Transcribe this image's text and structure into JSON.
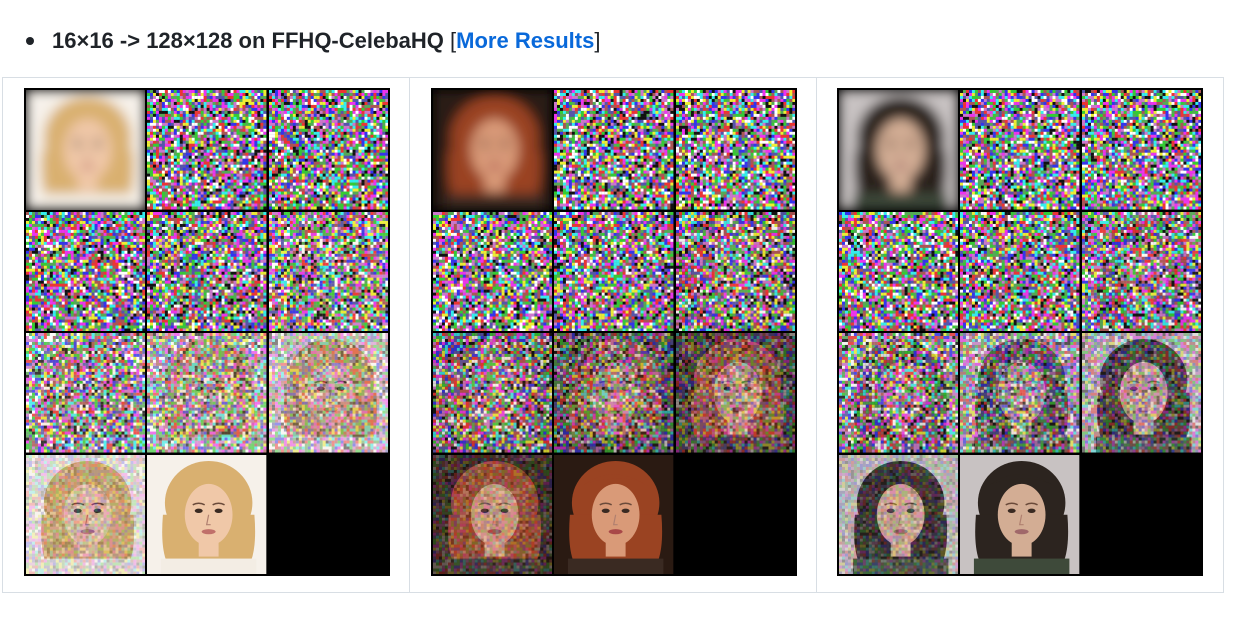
{
  "bullet": {
    "text": "16×16 -> 128×128 on FFHQ-CelebaHQ",
    "bracket_open": "[",
    "link_label": "More Results",
    "bracket_close": "]"
  },
  "colors": {
    "link": "#0969da",
    "text": "#1f2328",
    "border": "#d8dee4"
  },
  "panels": [
    {
      "name": "blonde-woman",
      "skin": "#f0c8a8",
      "hair": "#d9b070",
      "bg": "#f6f1ea",
      "shirt": "#f3ede4",
      "mouth": "#c0706a",
      "tiles": [
        {
          "kind": "lowres",
          "noise": 0.0
        },
        {
          "kind": "noise",
          "noise": 1.0
        },
        {
          "kind": "noise",
          "noise": 1.0
        },
        {
          "kind": "noise",
          "noise": 1.0
        },
        {
          "kind": "noise",
          "noise": 0.98
        },
        {
          "kind": "noisy",
          "noise": 0.92
        },
        {
          "kind": "noisy",
          "noise": 0.82
        },
        {
          "kind": "noisy",
          "noise": 0.66
        },
        {
          "kind": "noisy",
          "noise": 0.48
        },
        {
          "kind": "noisy",
          "noise": 0.25
        },
        {
          "kind": "clean",
          "noise": 0.0
        },
        {
          "kind": "empty",
          "noise": 0.0
        }
      ]
    },
    {
      "name": "redhead-woman",
      "skin": "#d99a78",
      "hair": "#9a4322",
      "bg": "#2a1a12",
      "shirt": "#3a2a22",
      "mouth": "#a84848",
      "tiles": [
        {
          "kind": "lowres",
          "noise": 0.0
        },
        {
          "kind": "noise",
          "noise": 1.0
        },
        {
          "kind": "noise",
          "noise": 1.0
        },
        {
          "kind": "noise",
          "noise": 1.0
        },
        {
          "kind": "noise",
          "noise": 0.98
        },
        {
          "kind": "noisy",
          "noise": 0.92
        },
        {
          "kind": "noisy",
          "noise": 0.82
        },
        {
          "kind": "noisy",
          "noise": 0.64
        },
        {
          "kind": "noisy",
          "noise": 0.46
        },
        {
          "kind": "noisy",
          "noise": 0.26
        },
        {
          "kind": "clean",
          "noise": 0.0
        },
        {
          "kind": "empty",
          "noise": 0.0
        }
      ]
    },
    {
      "name": "young-man",
      "skin": "#d3ad94",
      "hair": "#2c241f",
      "bg": "#c8c2c2",
      "shirt": "#3e4a3a",
      "mouth": "#a0686a",
      "tiles": [
        {
          "kind": "lowres",
          "noise": 0.0
        },
        {
          "kind": "noise",
          "noise": 1.0
        },
        {
          "kind": "noise",
          "noise": 1.0
        },
        {
          "kind": "noise",
          "noise": 1.0
        },
        {
          "kind": "noise",
          "noise": 0.98
        },
        {
          "kind": "noisy",
          "noise": 0.92
        },
        {
          "kind": "noisy",
          "noise": 0.82
        },
        {
          "kind": "noisy",
          "noise": 0.64
        },
        {
          "kind": "noisy",
          "noise": 0.46
        },
        {
          "kind": "noisy",
          "noise": 0.26
        },
        {
          "kind": "clean",
          "noise": 0.0
        },
        {
          "kind": "empty",
          "noise": 0.0
        }
      ]
    }
  ]
}
